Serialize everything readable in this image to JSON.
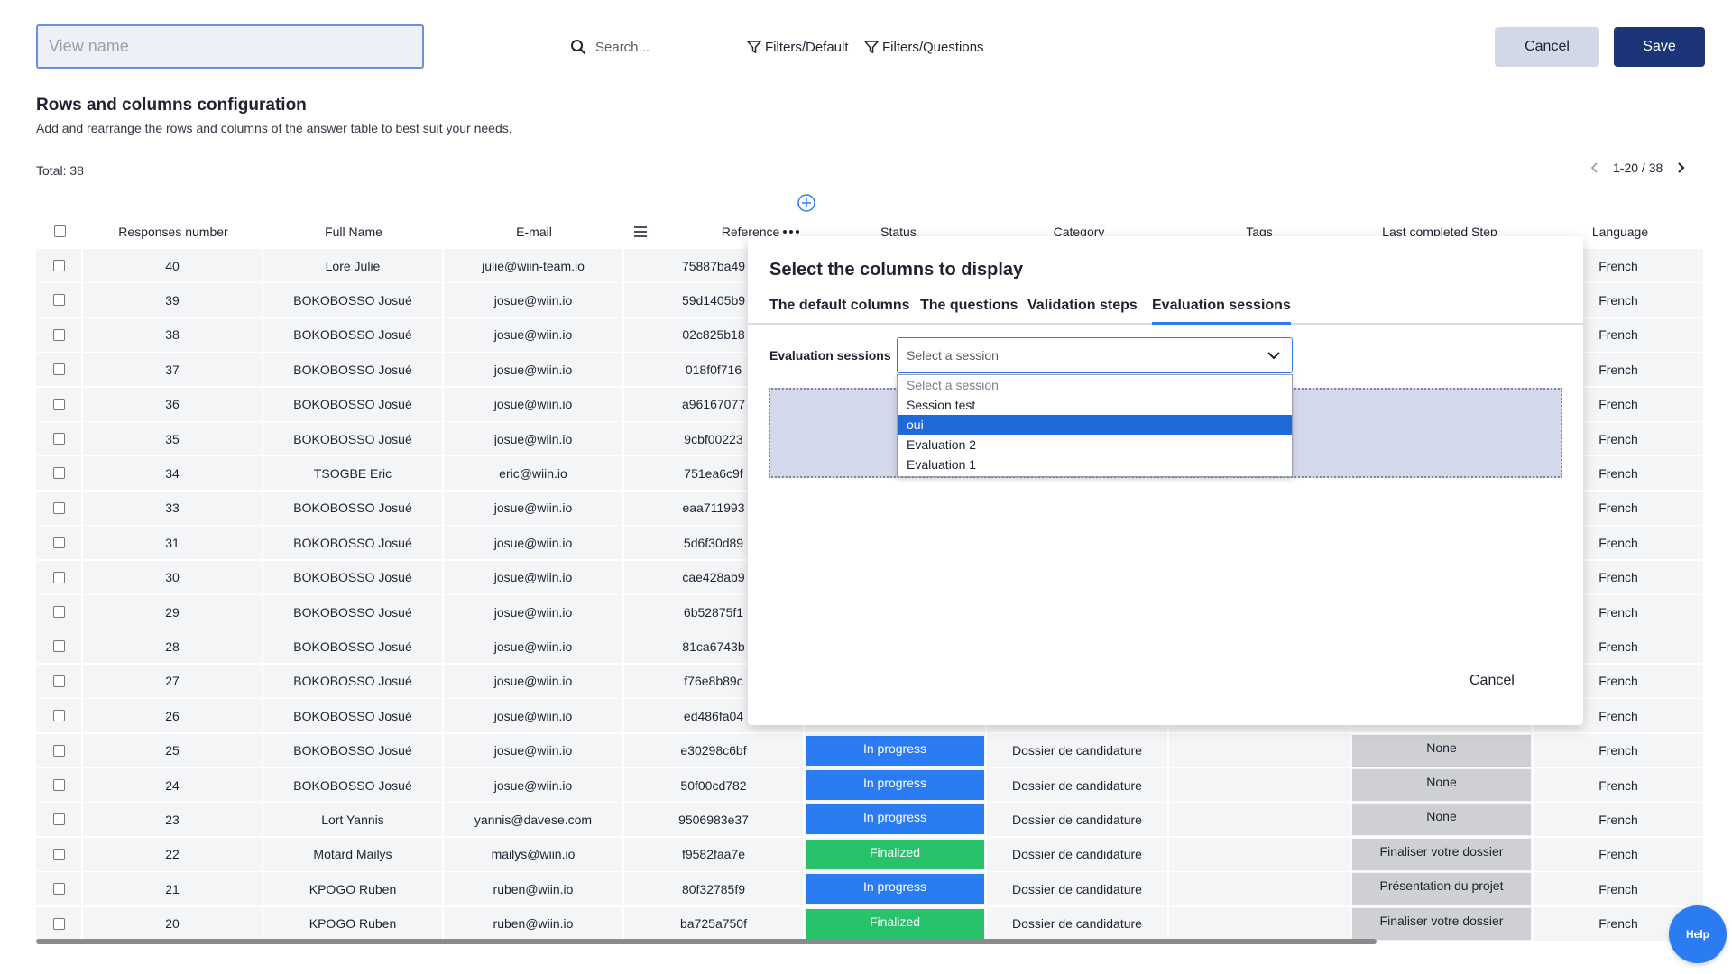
{
  "toolbar": {
    "view_name_placeholder": "View name",
    "search_placeholder": "Search...",
    "filter_default_label": "Filters/Default",
    "filter_questions_label": "Filters/Questions",
    "cancel_label": "Cancel",
    "save_label": "Save",
    "accent_color": "#1c3478"
  },
  "section": {
    "title": "Rows and columns configuration",
    "subtitle": "Add and rearrange the rows and columns of the answer table to best suit your needs.",
    "total": "Total: 38",
    "pager": "1-20 / 38"
  },
  "table": {
    "headers": {
      "number": "Responses number",
      "name": "Full Name",
      "email": "E-mail",
      "reference": "Reference",
      "status": "Status",
      "category": "Category",
      "tags": "Tags",
      "step": "Last completed Step",
      "language": "Language"
    },
    "rows": [
      {
        "number": "40",
        "name": "Lore Julie",
        "email": "julie@wiin-team.io",
        "reference": "75887ba49",
        "status": "",
        "category": "",
        "step": "",
        "language": "French"
      },
      {
        "number": "39",
        "name": "BOKOBOSSO Josué",
        "email": "josue@wiin.io",
        "reference": "59d1405b9",
        "status": "",
        "category": "",
        "step": "",
        "language": "French"
      },
      {
        "number": "38",
        "name": "BOKOBOSSO Josué",
        "email": "josue@wiin.io",
        "reference": "02c825b18",
        "status": "",
        "category": "",
        "step": "",
        "language": "French"
      },
      {
        "number": "37",
        "name": "BOKOBOSSO Josué",
        "email": "josue@wiin.io",
        "reference": "018f0f716",
        "status": "",
        "category": "",
        "step": "",
        "language": "French"
      },
      {
        "number": "36",
        "name": "BOKOBOSSO Josué",
        "email": "josue@wiin.io",
        "reference": "a96167077",
        "status": "",
        "category": "",
        "step": "",
        "language": "French"
      },
      {
        "number": "35",
        "name": "BOKOBOSSO Josué",
        "email": "josue@wiin.io",
        "reference": "9cbf00223",
        "status": "",
        "category": "",
        "step": "",
        "language": "French"
      },
      {
        "number": "34",
        "name": "TSOGBE Eric",
        "email": "eric@wiin.io",
        "reference": "751ea6c9f",
        "status": "",
        "category": "",
        "step": "",
        "language": "French"
      },
      {
        "number": "33",
        "name": "BOKOBOSSO Josué",
        "email": "josue@wiin.io",
        "reference": "eaa711993",
        "status": "",
        "category": "",
        "step": "",
        "language": "French"
      },
      {
        "number": "31",
        "name": "BOKOBOSSO Josué",
        "email": "josue@wiin.io",
        "reference": "5d6f30d89",
        "status": "",
        "category": "",
        "step": "",
        "language": "French"
      },
      {
        "number": "30",
        "name": "BOKOBOSSO Josué",
        "email": "josue@wiin.io",
        "reference": "cae428ab9",
        "status": "",
        "category": "",
        "step": "",
        "language": "French"
      },
      {
        "number": "29",
        "name": "BOKOBOSSO Josué",
        "email": "josue@wiin.io",
        "reference": "6b52875f1",
        "status": "",
        "category": "",
        "step": "",
        "language": "French"
      },
      {
        "number": "28",
        "name": "BOKOBOSSO Josué",
        "email": "josue@wiin.io",
        "reference": "81ca6743b",
        "status": "",
        "category": "",
        "step": "",
        "language": "French"
      },
      {
        "number": "27",
        "name": "BOKOBOSSO Josué",
        "email": "josue@wiin.io",
        "reference": "f76e8b89c",
        "status": "",
        "category": "",
        "step": "",
        "language": "French"
      },
      {
        "number": "26",
        "name": "BOKOBOSSO Josué",
        "email": "josue@wiin.io",
        "reference": "ed486fa04",
        "status": "",
        "category": "",
        "step": "",
        "language": "French"
      },
      {
        "number": "25",
        "name": "BOKOBOSSO Josué",
        "email": "josue@wiin.io",
        "reference": "e30298c6bf",
        "status": "In progress",
        "category": "Dossier de candidature",
        "step": "None",
        "language": "French"
      },
      {
        "number": "24",
        "name": "BOKOBOSSO Josué",
        "email": "josue@wiin.io",
        "reference": "50f00cd782",
        "status": "In progress",
        "category": "Dossier de candidature",
        "step": "None",
        "language": "French"
      },
      {
        "number": "23",
        "name": "Lort Yannis",
        "email": "yannis@davese.com",
        "reference": "9506983e37",
        "status": "In progress",
        "category": "Dossier de candidature",
        "step": "None",
        "language": "French"
      },
      {
        "number": "22",
        "name": "Motard Mailys",
        "email": "mailys@wiin.io",
        "reference": "f9582faa7e",
        "status": "Finalized",
        "category": "Dossier de candidature",
        "step": "Finaliser votre dossier",
        "language": "French"
      },
      {
        "number": "21",
        "name": "KPOGO Ruben",
        "email": "ruben@wiin.io",
        "reference": "80f32785f9",
        "status": "In progress",
        "category": "Dossier de candidature",
        "step": "Présentation du projet",
        "language": "French"
      },
      {
        "number": "20",
        "name": "KPOGO Ruben",
        "email": "ruben@wiin.io",
        "reference": "ba725a750f",
        "status": "Finalized",
        "category": "Dossier de candidature",
        "step": "Finaliser votre dossier",
        "language": "French"
      }
    ],
    "status_colors": {
      "in_progress": "#2b7bf3",
      "finalized": "#27c26a"
    }
  },
  "modal": {
    "title": "Select the columns to display",
    "tabs": [
      "The default columns",
      "The questions",
      "Validation steps",
      "Evaluation sessions"
    ],
    "active_tab": "Evaluation sessions",
    "select_label": "Evaluation sessions",
    "select_value": "Select a session",
    "options": [
      "Select a session",
      "Session test",
      "oui",
      "Evaluation 2",
      "Evaluation 1"
    ],
    "highlighted_option": "oui",
    "cancel_label": "Cancel"
  },
  "help": {
    "label": "Help"
  }
}
